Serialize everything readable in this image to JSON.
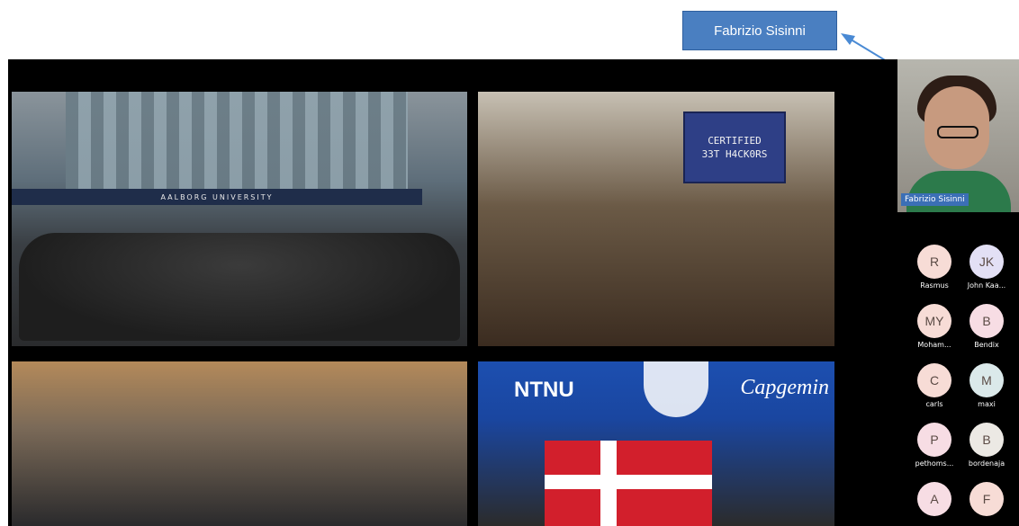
{
  "callout": {
    "label": "Fabrizio Sisinni"
  },
  "tiles": {
    "aalborg_banner": "AALBORG UNIVERSITY",
    "screen_lines": [
      "CERTIFIED",
      "33T H4CK0RS"
    ],
    "ntnu_text": "NTNU",
    "capgemini_text": "Capgemin"
  },
  "presenter": {
    "name": "Fabrizio Sisinni"
  },
  "participants": [
    {
      "initials": "R",
      "name": "Rasmus",
      "color": "#f7dcd6"
    },
    {
      "initials": "JK",
      "name": "John Kaa...",
      "color": "#e3e0f5"
    },
    {
      "initials": "MY",
      "name": "Moham...",
      "color": "#f7dcd6"
    },
    {
      "initials": "B",
      "name": "Bendix",
      "color": "#f7dde4"
    },
    {
      "initials": "C",
      "name": "carls",
      "color": "#f7dcd6"
    },
    {
      "initials": "M",
      "name": "maxi",
      "color": "#dbe9ea"
    },
    {
      "initials": "P",
      "name": "pethoms...",
      "color": "#f7dde4"
    },
    {
      "initials": "B",
      "name": "bordenaja",
      "color": "#ece9e4"
    },
    {
      "initials": "A",
      "name": "",
      "color": "#f7dde4"
    },
    {
      "initials": "F",
      "name": "",
      "color": "#f7dcd6"
    }
  ]
}
